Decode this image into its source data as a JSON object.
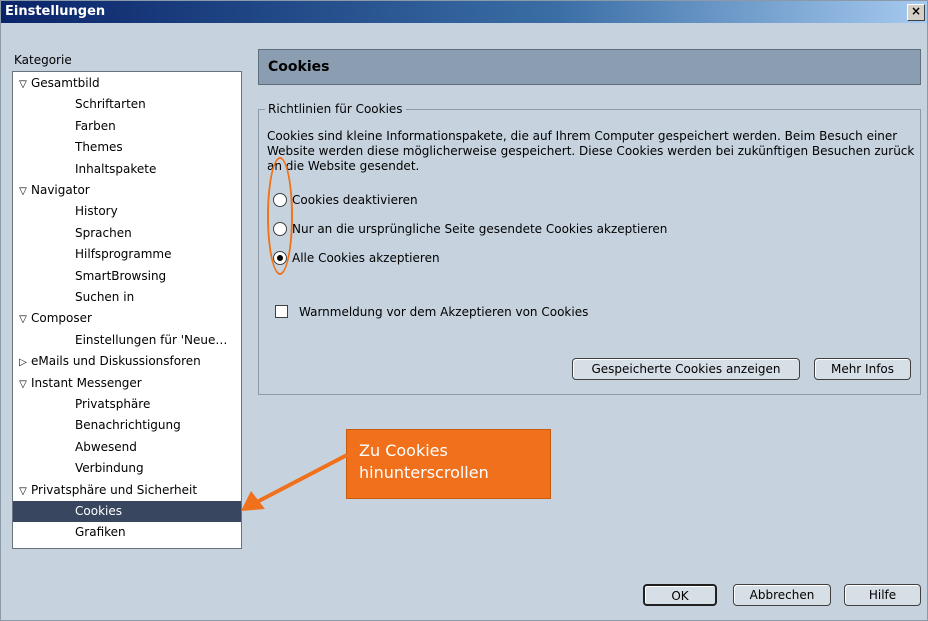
{
  "window": {
    "title": "Einstellungen",
    "close_glyph": "×"
  },
  "category_label": "Kategorie",
  "tree": [
    {
      "label": "Gesamtbild",
      "level": 1,
      "twisty": "▽"
    },
    {
      "label": "Schriftarten",
      "level": 2
    },
    {
      "label": "Farben",
      "level": 2
    },
    {
      "label": "Themes",
      "level": 2
    },
    {
      "label": "Inhaltspakete",
      "level": 2
    },
    {
      "label": "Navigator",
      "level": 1,
      "twisty": "▽"
    },
    {
      "label": "History",
      "level": 2
    },
    {
      "label": "Sprachen",
      "level": 2
    },
    {
      "label": "Hilfsprogramme",
      "level": 2
    },
    {
      "label": "SmartBrowsing",
      "level": 2
    },
    {
      "label": "Suchen in",
      "level": 2
    },
    {
      "label": "Composer",
      "level": 1,
      "twisty": "▽"
    },
    {
      "label": "Einstellungen für 'Neue…",
      "level": 2
    },
    {
      "label": "eMails und Diskussionsforen",
      "level": 1,
      "twisty": "▷"
    },
    {
      "label": "Instant Messenger",
      "level": 1,
      "twisty": "▽"
    },
    {
      "label": "Privatsphäre",
      "level": 2
    },
    {
      "label": "Benachrichtigung",
      "level": 2
    },
    {
      "label": "Abwesend",
      "level": 2
    },
    {
      "label": "Verbindung",
      "level": 2
    },
    {
      "label": "Privatsphäre und Sicherheit",
      "level": 1,
      "twisty": "▽"
    },
    {
      "label": "Cookies",
      "level": 2,
      "selected": true
    },
    {
      "label": "Grafiken",
      "level": 2
    }
  ],
  "panel": {
    "title": "Cookies",
    "group_legend": "Richtlinien für Cookies",
    "description": "Cookies sind kleine Informationspakete, die auf Ihrem Computer gespeichert werden. Beim Besuch einer Website werden diese möglicherweise gespeichert. Diese Cookies werden bei zukünftigen Besuchen zurück an die Website gesendet.",
    "radios": [
      {
        "label": "Cookies deaktivieren",
        "checked": false
      },
      {
        "label": "Nur an die ursprüngliche Seite gesendete Cookies akzeptieren",
        "checked": false
      },
      {
        "label": "Alle Cookies akzeptieren",
        "checked": true
      }
    ],
    "warn_checkbox": {
      "label": "Warnmeldung vor dem Akzeptieren von Cookies",
      "checked": false
    },
    "show_cookies_button": "Gespeicherte Cookies anzeigen",
    "more_info_button": "Mehr Infos"
  },
  "footer": {
    "ok": "OK",
    "cancel": "Abbrechen",
    "help": "Hilfe"
  },
  "annotation": {
    "callout_line1": "Zu Cookies",
    "callout_line2": "hinunterscrollen",
    "color": "#f0701c"
  },
  "colors": {
    "selection": "#394660",
    "dialog_bg": "#c6d3df",
    "header_bg": "#8b9db0"
  }
}
